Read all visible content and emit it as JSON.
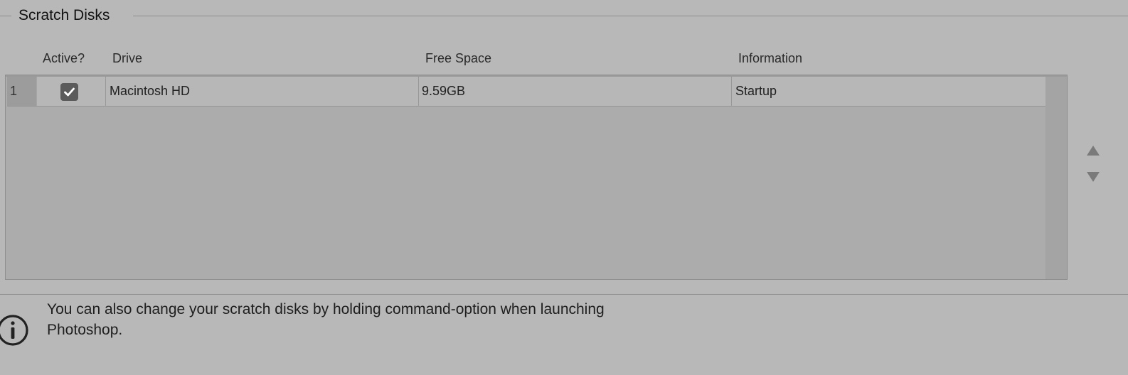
{
  "group": {
    "title": "Scratch Disks"
  },
  "table": {
    "columns": {
      "active": "Active?",
      "drive": "Drive",
      "free_space": "Free Space",
      "information": "Information"
    },
    "rows": [
      {
        "number": "1",
        "active": true,
        "drive": "Macintosh HD",
        "free_space": "9.59GB",
        "information": "Startup"
      }
    ]
  },
  "controls": {
    "move_up_icon": "triangle-up",
    "move_down_icon": "triangle-down"
  },
  "info": {
    "icon": "info-icon",
    "message": "You can also change your scratch disks by holding command-option when launching Photoshop."
  },
  "colors": {
    "background": "#b8b8b8",
    "table_background": "#acacac",
    "checkbox_fill": "#5b5b5b",
    "arrow": "#7a7a7a"
  }
}
